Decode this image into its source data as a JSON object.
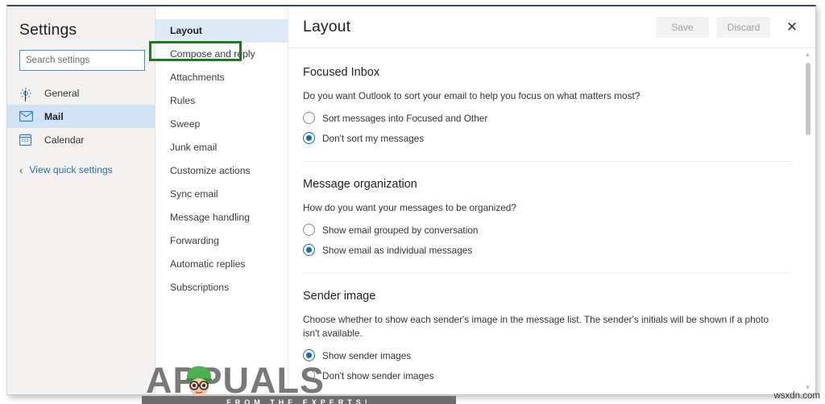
{
  "window": {
    "accent_color": "#0f6cbd",
    "highlight_color": "#1c7a1c"
  },
  "settings_pane": {
    "title": "Settings",
    "search": {
      "placeholder": "Search settings",
      "value": ""
    },
    "items": [
      {
        "label": "General",
        "icon": "gear-icon",
        "selected": false
      },
      {
        "label": "Mail",
        "icon": "envelope-icon",
        "selected": true
      },
      {
        "label": "Calendar",
        "icon": "calendar-icon",
        "selected": false
      }
    ],
    "quick_settings": {
      "label": "View quick settings",
      "icon": "chevron-left-icon"
    }
  },
  "subnav": {
    "items": [
      {
        "label": "Layout",
        "selected": true,
        "highlighted": false
      },
      {
        "label": "Compose and reply",
        "selected": false,
        "highlighted": true
      },
      {
        "label": "Attachments",
        "selected": false,
        "highlighted": false
      },
      {
        "label": "Rules",
        "selected": false,
        "highlighted": false
      },
      {
        "label": "Sweep",
        "selected": false,
        "highlighted": false
      },
      {
        "label": "Junk email",
        "selected": false,
        "highlighted": false
      },
      {
        "label": "Customize actions",
        "selected": false,
        "highlighted": false
      },
      {
        "label": "Sync email",
        "selected": false,
        "highlighted": false
      },
      {
        "label": "Message handling",
        "selected": false,
        "highlighted": false
      },
      {
        "label": "Forwarding",
        "selected": false,
        "highlighted": false
      },
      {
        "label": "Automatic replies",
        "selected": false,
        "highlighted": false
      },
      {
        "label": "Subscriptions",
        "selected": false,
        "highlighted": false
      }
    ]
  },
  "content": {
    "title": "Layout",
    "save_label": "Save",
    "discard_label": "Discard",
    "close_icon": "close-icon",
    "sections": [
      {
        "heading": "Focused Inbox",
        "description": "Do you want Outlook to sort your email to help you focus on what matters most?",
        "options": [
          {
            "label": "Sort messages into Focused and Other",
            "checked": false
          },
          {
            "label": "Don't sort my messages",
            "checked": true
          }
        ]
      },
      {
        "heading": "Message organization",
        "description": "How do you want your messages to be organized?",
        "options": [
          {
            "label": "Show email grouped by conversation",
            "checked": false
          },
          {
            "label": "Show email as individual messages",
            "checked": true
          }
        ]
      },
      {
        "heading": "Sender image",
        "description": "Choose whether to show each sender's image in the message list. The sender's initials will be shown if a photo isn't available.",
        "options": [
          {
            "label": "Show sender images",
            "checked": true
          },
          {
            "label": "Don't show sender images",
            "checked": false
          }
        ]
      }
    ],
    "scrollbar": {
      "up_arrow": "▲",
      "down_arrow": "▼"
    }
  },
  "watermarks": {
    "brand": "APPUALS",
    "tagline": "FROM THE EXPERTS!",
    "site": "wsxdn.com"
  }
}
